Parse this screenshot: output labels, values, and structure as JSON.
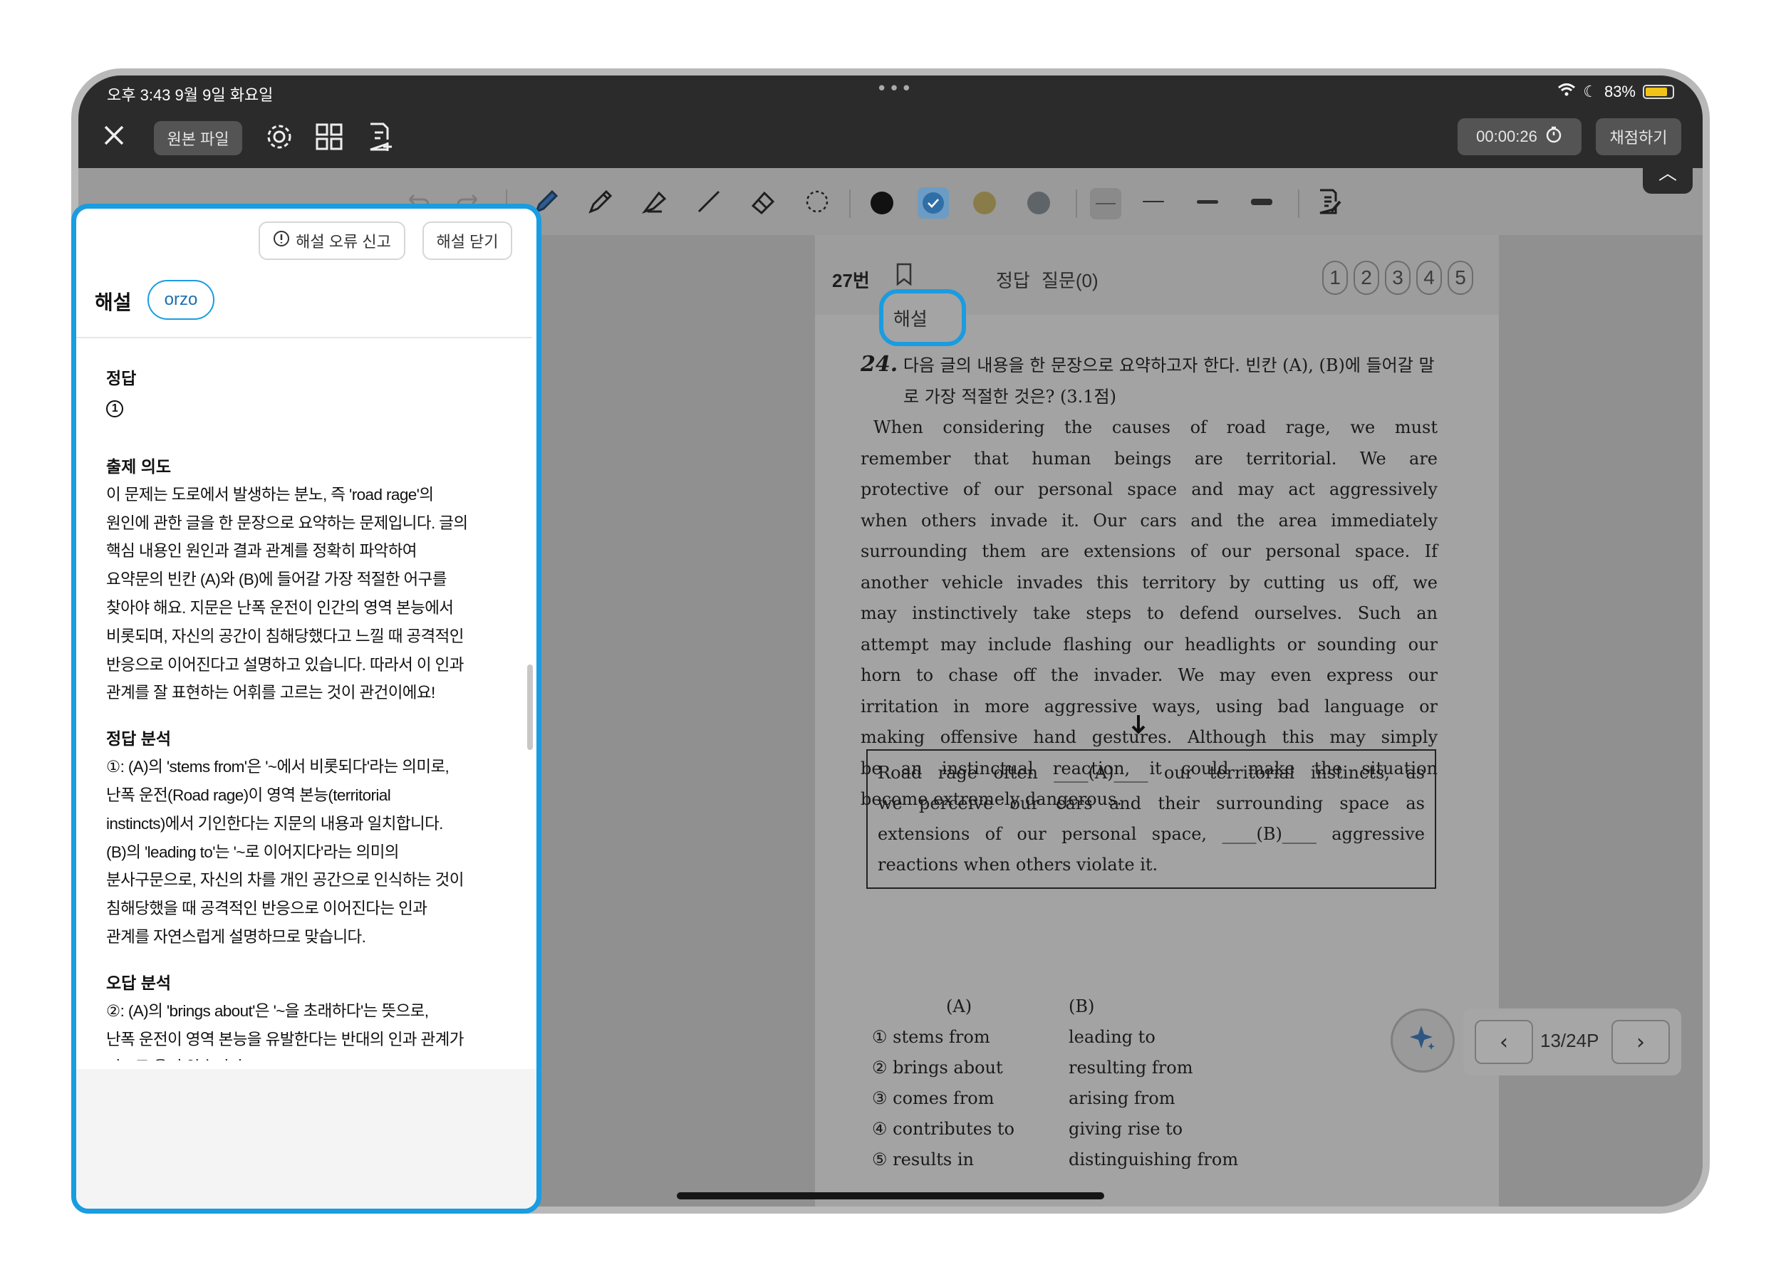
{
  "status": {
    "time": "오후 3:43  9월 9일 화요일",
    "battery": "83%",
    "battery_level": 0.83
  },
  "appbar": {
    "original_file": "원본 파일",
    "timer": "00:00:26",
    "grade": "채점하기"
  },
  "question": {
    "number": "27번",
    "tabs": {
      "explanation": "해설",
      "answer": "정답",
      "questions": "질문(0)"
    },
    "choices": [
      "1",
      "2",
      "3",
      "4",
      "5"
    ],
    "title_num": "24.",
    "title": "다음 글의 내용을 한 문장으로 요약하고자 한다. 빈칸 (A), (B)에 들어갈 말로 가장 적절한 것은? (3.1점)",
    "passage_lines": [
      "When considering the causes of road rage, we must",
      "remember that human beings are territorial. We are",
      "protective of our personal space and may act aggressively",
      "when others invade it. Our cars and the area immediately",
      "surrounding them are extensions of our personal space. If",
      "another vehicle invades this territory by cutting us off, we",
      "may instinctively take steps to defend ourselves. Such an",
      "attempt may include flashing our headlights or sounding our",
      "horn to chase off the invader. We may even express our",
      "irritation in more aggressive ways, using bad language or",
      "making offensive hand gestures. Although this may simply",
      "be an instinctual reaction, it could make the situation",
      "become extremely dangerous."
    ],
    "arrow": "➜",
    "summary_lines": [
      "Road rage often ____(A)____ our territorial instincts, as",
      "we perceive our cars and their surrounding space as",
      "extensions of our personal space, ____(B)____ aggressive",
      "reactions when others violate it."
    ],
    "options_header": {
      "a": "(A)",
      "b": "(B)"
    },
    "options": [
      {
        "a": "① stems from",
        "b": "leading to"
      },
      {
        "a": "② brings about",
        "b": "resulting from"
      },
      {
        "a": "③ comes from",
        "b": "arising from"
      },
      {
        "a": "④ contributes to",
        "b": "giving rise to"
      },
      {
        "a": "⑤ results in",
        "b": "distinguishing from"
      }
    ]
  },
  "pager": {
    "label": "13/24P"
  },
  "side": {
    "report_error": "해설 오류 신고",
    "close": "해설 닫기",
    "title": "해설",
    "badge": "orzo",
    "answer_h": "정답",
    "answer_v": "1",
    "intent_h": "출제 의도",
    "intent_lines": [
      "이 문제는 도로에서 발생하는 분노, 즉 'road rage'의",
      "원인에 관한 글을 한 문장으로 요약하는 문제입니다. 글의",
      "핵심 내용인 원인과 결과 관계를 정확히 파악하여",
      "요약문의 빈칸 (A)와 (B)에 들어갈 가장 적절한 어구를",
      "찾아야 해요. 지문은 난폭 운전이 인간의 영역 본능에서",
      "비롯되며, 자신의 공간이 침해당했다고 느낄 때 공격적인",
      "반응으로 이어진다고 설명하고 있습니다. 따라서 이 인과",
      "관계를 잘 표현하는 어휘를 고르는 것이 관건이에요!"
    ],
    "analysis_h": "정답 분석",
    "analysis_lines": [
      "①: (A)의 'stems from'은 '~에서 비롯되다'라는 의미로,",
      "난폭 운전(Road rage)이 영역 본능(territorial",
      "instincts)에서 기인한다는 지문의 내용과 일치합니다.",
      "(B)의 'leading to'는 '~로 이어지다'라는 의미의",
      "분사구문으로, 자신의 차를 개인 공간으로 인식하는 것이",
      "침해당했을 때 공격적인 반응으로 이어진다는 인과",
      "관계를 자연스럽게 설명하므로 맞습니다."
    ],
    "wrong_h": "오답 분석",
    "wrong_lines": [
      "②: (A)의 'brings about'은 '~을 초래하다'는 뜻으로,",
      "난폭 운전이 영역 본능을 유발한다는 반대의 인과 관계가",
      "되므로 옳지 않습니다."
    ]
  },
  "colors": {
    "accent": "#1a9ce0",
    "battery": "#f4c318",
    "dark_bar": "#2b2b2b"
  }
}
